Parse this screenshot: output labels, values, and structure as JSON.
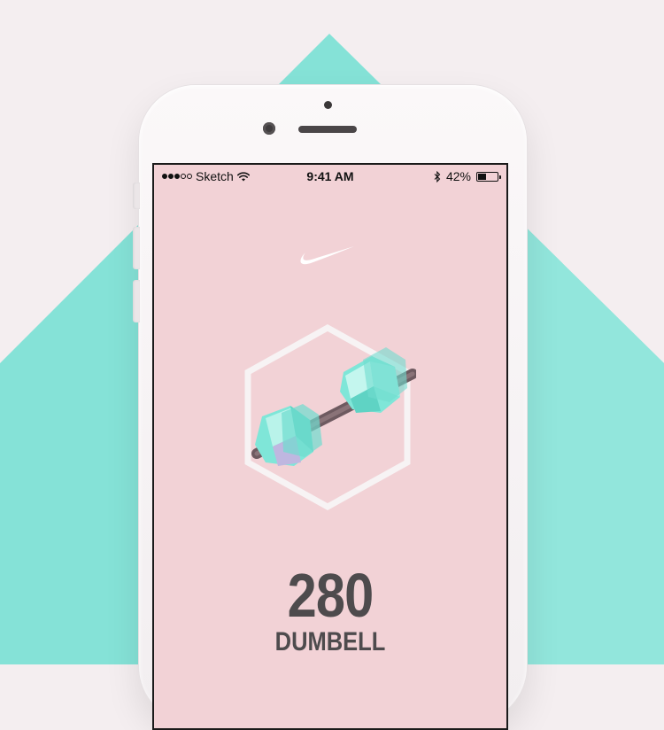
{
  "status_bar": {
    "carrier": "Sketch",
    "time": "9:41 AM",
    "battery_percent_label": "42%",
    "battery_level": 0.42,
    "signal_bars_filled": 3,
    "signal_bars_total": 5,
    "icons": [
      "wifi-icon",
      "bluetooth-icon",
      "battery-icon"
    ]
  },
  "brand": {
    "logo_icon": "swoosh-logo-icon"
  },
  "hero": {
    "icon": "dumbbell-icon",
    "frame_icon": "hexagon-frame-icon"
  },
  "workout": {
    "count": "280",
    "exercise": "DUMBELL"
  },
  "colors": {
    "background": "#f4eef0",
    "accent_teal": "#7fe0d4",
    "screen_pink": "#f2d2d6",
    "text_dark": "#4e4b4d",
    "phone_white": "#f8f5f6"
  }
}
